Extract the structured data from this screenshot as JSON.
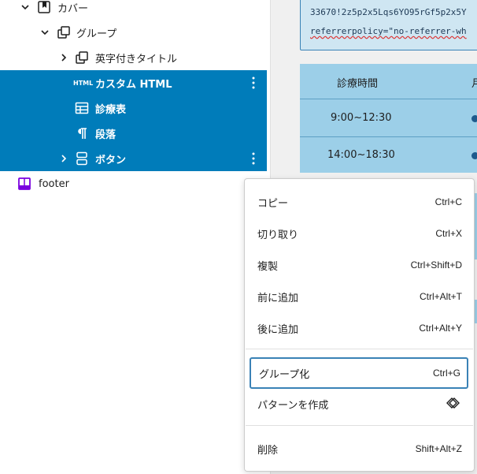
{
  "list_view": {
    "items": [
      {
        "label": "カバー",
        "icon": "cover-block-icon",
        "expanded": true,
        "selected": false
      },
      {
        "label": "グループ",
        "icon": "group-block-icon",
        "expanded": true,
        "selected": false
      },
      {
        "label": "英字付きタイトル",
        "icon": "group-block-icon",
        "expanded": false,
        "selected": false
      },
      {
        "label": "カスタム HTML",
        "icon_text": "HTML",
        "selected": true
      },
      {
        "label": "診療表",
        "icon": "table-block-icon",
        "selected": true
      },
      {
        "label": "段落",
        "icon": "paragraph-block-icon",
        "selected": true
      },
      {
        "label": "ボタン",
        "icon": "buttons-block-icon",
        "expanded": false,
        "selected": true
      },
      {
        "label": "footer",
        "icon": "template-part-icon",
        "selected": false
      }
    ]
  },
  "preview": {
    "code_line1": "33670!2z5p2x5Lqs6YO95rGf5p2x5Y",
    "code_line2": "referrerpolicy=\"no-referrer-wh",
    "table": {
      "header": "診療時間",
      "header_next": "月",
      "rows": [
        "9:00~12:30",
        "14:00~18:30"
      ]
    }
  },
  "context_menu": {
    "items": [
      {
        "label": "コピー",
        "shortcut": "Ctrl+C"
      },
      {
        "label": "切り取り",
        "shortcut": "Ctrl+X"
      },
      {
        "label": "複製",
        "shortcut": "Ctrl+Shift+D"
      },
      {
        "label": "前に追加",
        "shortcut": "Ctrl+Alt+T"
      },
      {
        "label": "後に追加",
        "shortcut": "Ctrl+Alt+Y"
      },
      {
        "label": "グループ化",
        "shortcut": "Ctrl+G",
        "focused": true
      },
      {
        "label": "パターンを作成",
        "icon": "pattern-diamond-icon"
      },
      {
        "label": "削除",
        "shortcut": "Shift+Alt+Z"
      }
    ]
  },
  "colors": {
    "selection": "#007cba",
    "table_bg": "#9ccfe8",
    "code_bg": "#cfe6f2",
    "footer_icon": "#7a00df"
  }
}
